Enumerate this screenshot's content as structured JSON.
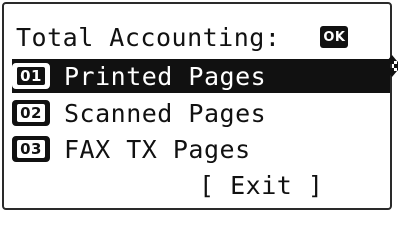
{
  "header": {
    "title": "Total Accounting:",
    "nav_icon": "four-way-arrow-icon",
    "ok_label": "OK"
  },
  "menu": {
    "items": [
      {
        "number": "01",
        "label": "Printed Pages",
        "selected": true
      },
      {
        "number": "02",
        "label": "Scanned Pages",
        "selected": false
      },
      {
        "number": "03",
        "label": "FAX TX Pages",
        "selected": false
      }
    ]
  },
  "exit": {
    "label": "[ Exit ]"
  },
  "colors": {
    "foreground": "#111111",
    "background": "#ffffff"
  }
}
